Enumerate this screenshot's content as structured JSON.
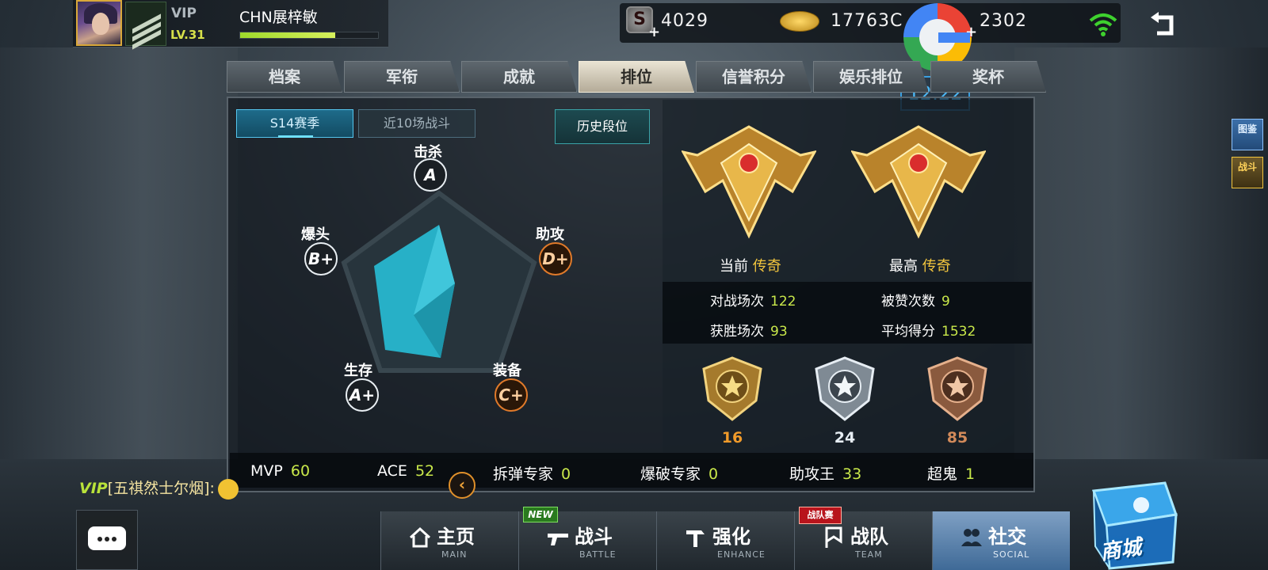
{
  "player": {
    "vip": "VIP",
    "level": "LV.31",
    "name": "CHN展梓敏",
    "xp_fraction": 0.69
  },
  "currencies": {
    "s_icon": "S",
    "s_value": "4029",
    "gold_value": "17763C",
    "diamond_value": "2302"
  },
  "clock": "12:22",
  "tabs": [
    "档案",
    "军衔",
    "成就",
    "排位",
    "信誉积分",
    "娱乐排位",
    "奖杯"
  ],
  "active_tab": "排位",
  "segments": {
    "season": "S14赛季",
    "recent": "近10场战斗",
    "history": "历史段位"
  },
  "radar": {
    "kill": {
      "label": "击杀",
      "grade": "A"
    },
    "assist": {
      "label": "助攻",
      "grade": "D+"
    },
    "equip": {
      "label": "装备",
      "grade": "C+"
    },
    "survive": {
      "label": "生存",
      "grade": "A+"
    },
    "headshot": {
      "label": "爆头",
      "grade": "B+"
    }
  },
  "rank": {
    "current_label": "当前",
    "current_value": "传奇",
    "highest_label": "最高",
    "highest_value": "传奇"
  },
  "stats": {
    "battles_label": "对战场次",
    "battles": "122",
    "likes_label": "被赞次数",
    "likes": "9",
    "wins_label": "获胜场次",
    "wins": "93",
    "avg_label": "平均得分",
    "avg": "1532"
  },
  "medals": {
    "gold": "16",
    "silver": "24",
    "bronze": "85"
  },
  "bottom": {
    "mvp_label": "MVP",
    "mvp": "60",
    "ace_label": "ACE",
    "ace": "52",
    "defuse_label": "拆弹专家",
    "defuse": "0",
    "blast_label": "爆破专家",
    "blast": "0",
    "assist_label": "助攻王",
    "assist": "33",
    "ghost_label": "超鬼",
    "ghost": "1"
  },
  "chat": {
    "vip": "VIP",
    "text": "[五祺然士尔烟]:"
  },
  "nav": [
    {
      "label": "主页",
      "sub": "MAIN"
    },
    {
      "label": "战斗",
      "sub": "BATTLE"
    },
    {
      "label": "强化",
      "sub": "ENHANCE"
    },
    {
      "label": "战队",
      "sub": "TEAM"
    },
    {
      "label": "社交",
      "sub": "SOCIAL"
    }
  ],
  "badges": {
    "new": "NEW",
    "team": "战队赛"
  },
  "shop_label": "商城",
  "side_tabs": {
    "archive": "图鉴",
    "battle": "战斗"
  },
  "colors": {
    "accent_green": "#c9e84a",
    "gold": "#f2c53d",
    "radar_fill": "#27b7cf"
  },
  "icons": [
    "s-currency-icon",
    "gold-coin-icon",
    "diamond-icon",
    "wifi-icon",
    "back-arrow-icon",
    "chat-icon",
    "home-icon",
    "gun-icon",
    "hammer-icon",
    "flag-icon",
    "people-icon"
  ]
}
